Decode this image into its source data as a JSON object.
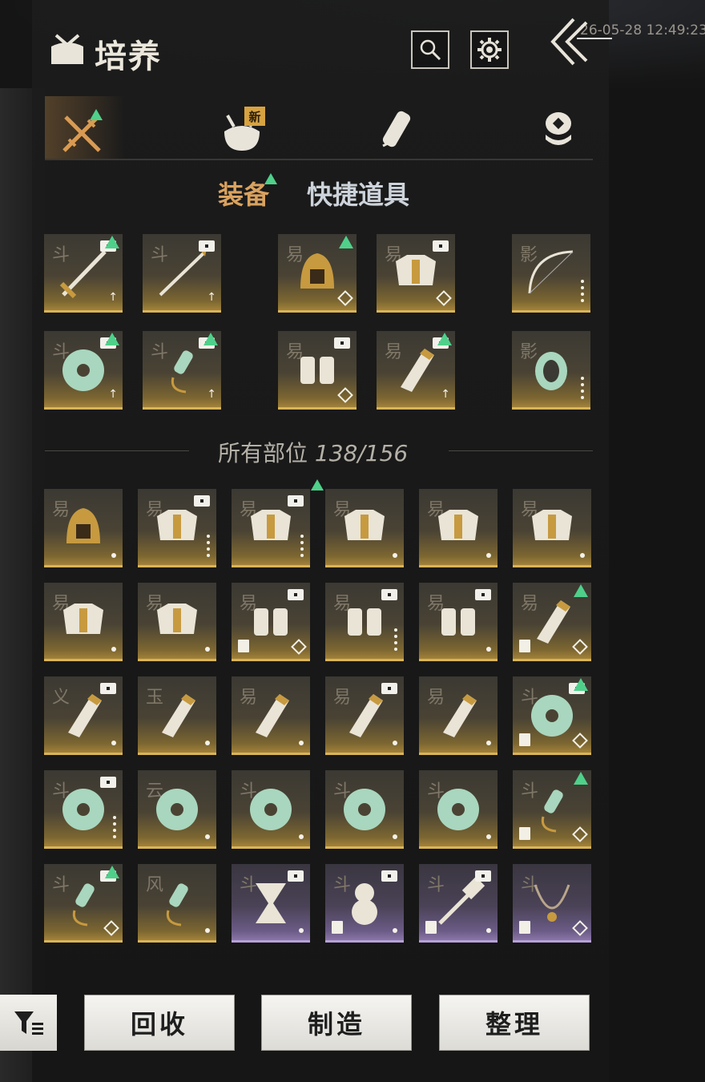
{
  "header": {
    "title": "培养",
    "timestamp": "26-05-28 12:49:23"
  },
  "category_tabs": [
    {
      "icon": "crossed-swords-icon",
      "active": true,
      "upgrade": true
    },
    {
      "icon": "bundle-icon",
      "badge": "新"
    },
    {
      "icon": "scroll-icon"
    },
    {
      "icon": "stacked-coins-icon"
    }
  ],
  "subtabs": {
    "equipment": "装备",
    "quick_items": "快捷道具"
  },
  "equipped": [
    {
      "glyph": "斗",
      "art": "sword",
      "mark": "arrow",
      "up": true,
      "lv": true
    },
    {
      "glyph": "斗",
      "art": "spear",
      "mark": "arrow",
      "lv": true
    },
    {
      "glyph": "易",
      "art": "helmet",
      "mark": "gem",
      "up": true,
      "lv": false
    },
    {
      "glyph": "易",
      "art": "armor",
      "mark": "gem",
      "lv": true
    },
    {
      "glyph": "影",
      "art": "bow",
      "mark": "dots"
    },
    {
      "glyph": "斗",
      "art": "disc",
      "mark": "arrow",
      "up": true,
      "lv": true
    },
    {
      "glyph": "斗",
      "art": "pendant",
      "mark": "arrow",
      "up": true,
      "lv": true
    },
    {
      "glyph": "易",
      "art": "gloves",
      "mark": "gem",
      "lv": true
    },
    {
      "glyph": "易",
      "art": "bracer",
      "mark": "arrow",
      "up": true,
      "lv": true
    },
    {
      "glyph": "影",
      "art": "ring",
      "mark": "dots"
    }
  ],
  "inventory_label": "所有部位",
  "inventory_count": "138/156",
  "inventory": [
    {
      "glyph": "易",
      "art": "helmet",
      "mark": "dot"
    },
    {
      "glyph": "易",
      "art": "armor",
      "mark": "dots",
      "lv": true
    },
    {
      "glyph": "易",
      "art": "armor",
      "mark": "dots",
      "lv": true
    },
    {
      "glyph": "易",
      "art": "armor",
      "mark": "dot"
    },
    {
      "glyph": "易",
      "art": "armor",
      "mark": "dot"
    },
    {
      "glyph": "易",
      "art": "armor",
      "mark": "dot"
    },
    {
      "glyph": "易",
      "art": "armor",
      "mark": "dot"
    },
    {
      "glyph": "易",
      "art": "armor",
      "mark": "dot"
    },
    {
      "glyph": "易",
      "art": "gloves",
      "mark": "gem",
      "lv": true,
      "book": true
    },
    {
      "glyph": "易",
      "art": "gloves",
      "mark": "dots",
      "lv": true
    },
    {
      "glyph": "易",
      "art": "gloves",
      "mark": "dot",
      "lv": true
    },
    {
      "glyph": "易",
      "art": "bracer",
      "mark": "gem",
      "up": true,
      "book": true
    },
    {
      "glyph": "义",
      "art": "bracer",
      "mark": "dot",
      "lv": true
    },
    {
      "glyph": "玉",
      "art": "bracer",
      "mark": "dot"
    },
    {
      "glyph": "易",
      "art": "bracer",
      "mark": "dot"
    },
    {
      "glyph": "易",
      "art": "bracer",
      "mark": "dot",
      "lv": true
    },
    {
      "glyph": "易",
      "art": "bracer",
      "mark": "dot"
    },
    {
      "glyph": "斗",
      "art": "disc",
      "mark": "gem",
      "lv": true,
      "up": true,
      "book": true
    },
    {
      "glyph": "斗",
      "art": "disc",
      "mark": "dots",
      "lv": true
    },
    {
      "glyph": "云",
      "art": "disc",
      "mark": "dot"
    },
    {
      "glyph": "斗",
      "art": "disc",
      "mark": "dot"
    },
    {
      "glyph": "斗",
      "art": "disc",
      "mark": "dot"
    },
    {
      "glyph": "斗",
      "art": "disc",
      "mark": "dot"
    },
    {
      "glyph": "斗",
      "art": "pendant",
      "mark": "gem",
      "up": true,
      "book": true
    },
    {
      "glyph": "斗",
      "art": "pendant",
      "mark": "gem",
      "up": true,
      "lv": true
    },
    {
      "glyph": "风",
      "art": "pendant",
      "mark": "dot"
    },
    {
      "glyph": "斗",
      "art": "hourglass",
      "mark": "dot",
      "lv": true,
      "purple": true
    },
    {
      "glyph": "斗",
      "art": "gourd",
      "mark": "dot",
      "lv": true,
      "purple": true,
      "book": true
    },
    {
      "glyph": "斗",
      "art": "hammer",
      "mark": "dot",
      "lv": true,
      "purple": true,
      "book": true
    },
    {
      "glyph": "斗",
      "art": "necklace",
      "mark": "gem",
      "purple": true,
      "book": true
    }
  ],
  "buttons": {
    "recycle": "回收",
    "craft": "制造",
    "sort": "整理"
  },
  "colors": {
    "accent_gold": "#d9a25f",
    "upgrade_green": "#4fd08a",
    "new_badge": "#d7a241",
    "purple_rarity": "#8a76a8",
    "gold_rarity": "#a2823a"
  }
}
